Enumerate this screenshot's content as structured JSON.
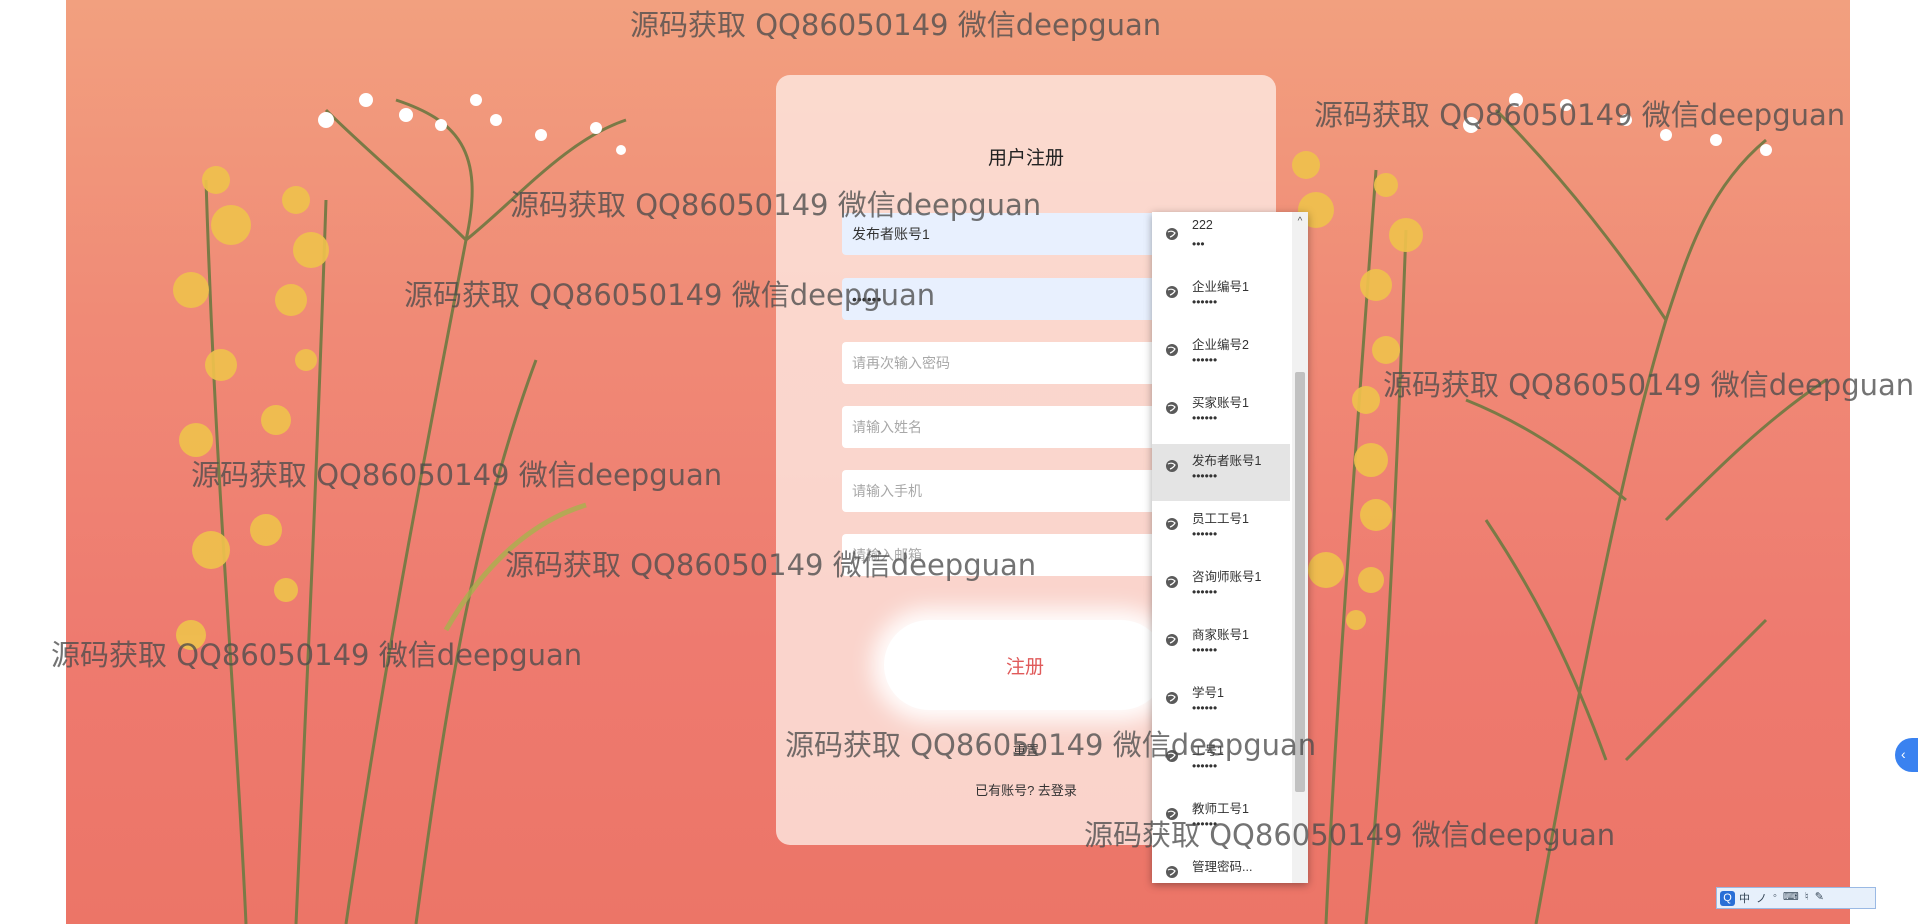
{
  "form": {
    "title": "用户注册",
    "account_value": "发布者账号1",
    "password_value": "••••••",
    "confirm_placeholder": "请再次输入密码",
    "name_placeholder": "请输入姓名",
    "phone_placeholder": "请输入手机",
    "extra_placeholder": "请输入邮箱",
    "register_label": "注册",
    "reset_label": "重置",
    "have_account_text": "已有账号?",
    "login_link": "去登录"
  },
  "autofill": {
    "items": [
      {
        "user": "222",
        "pass": "•••"
      },
      {
        "user": "企业编号1",
        "pass": "••••••"
      },
      {
        "user": "企业编号2",
        "pass": "••••••"
      },
      {
        "user": "买家账号1",
        "pass": "••••••"
      },
      {
        "user": "发布者账号1",
        "pass": "••••••",
        "highlighted": true
      },
      {
        "user": "员工工号1",
        "pass": "••••••"
      },
      {
        "user": "咨询师账号1",
        "pass": "••••••"
      },
      {
        "user": "商家账号1",
        "pass": "••••••"
      },
      {
        "user": "学号1",
        "pass": "••••••"
      },
      {
        "user": "工号1",
        "pass": "••••••"
      },
      {
        "user": "教师工号1",
        "pass": "••••••"
      },
      {
        "user": "管理密码...",
        "pass": ""
      }
    ],
    "scroll_up_glyph": "^"
  },
  "watermark_text": "源码获取 QQ86050149 微信deepguan",
  "ime": {
    "logo": "Q",
    "items": [
      "中",
      "ノ",
      "◦",
      "⌨",
      "♮",
      "✎"
    ]
  },
  "side_tab_glyph": "‹",
  "colors": {
    "background_top": "#f2a07f",
    "background_bottom": "#ec7567",
    "register_text": "#e05a5a",
    "autofill_highlight": "#e4e4e4"
  }
}
